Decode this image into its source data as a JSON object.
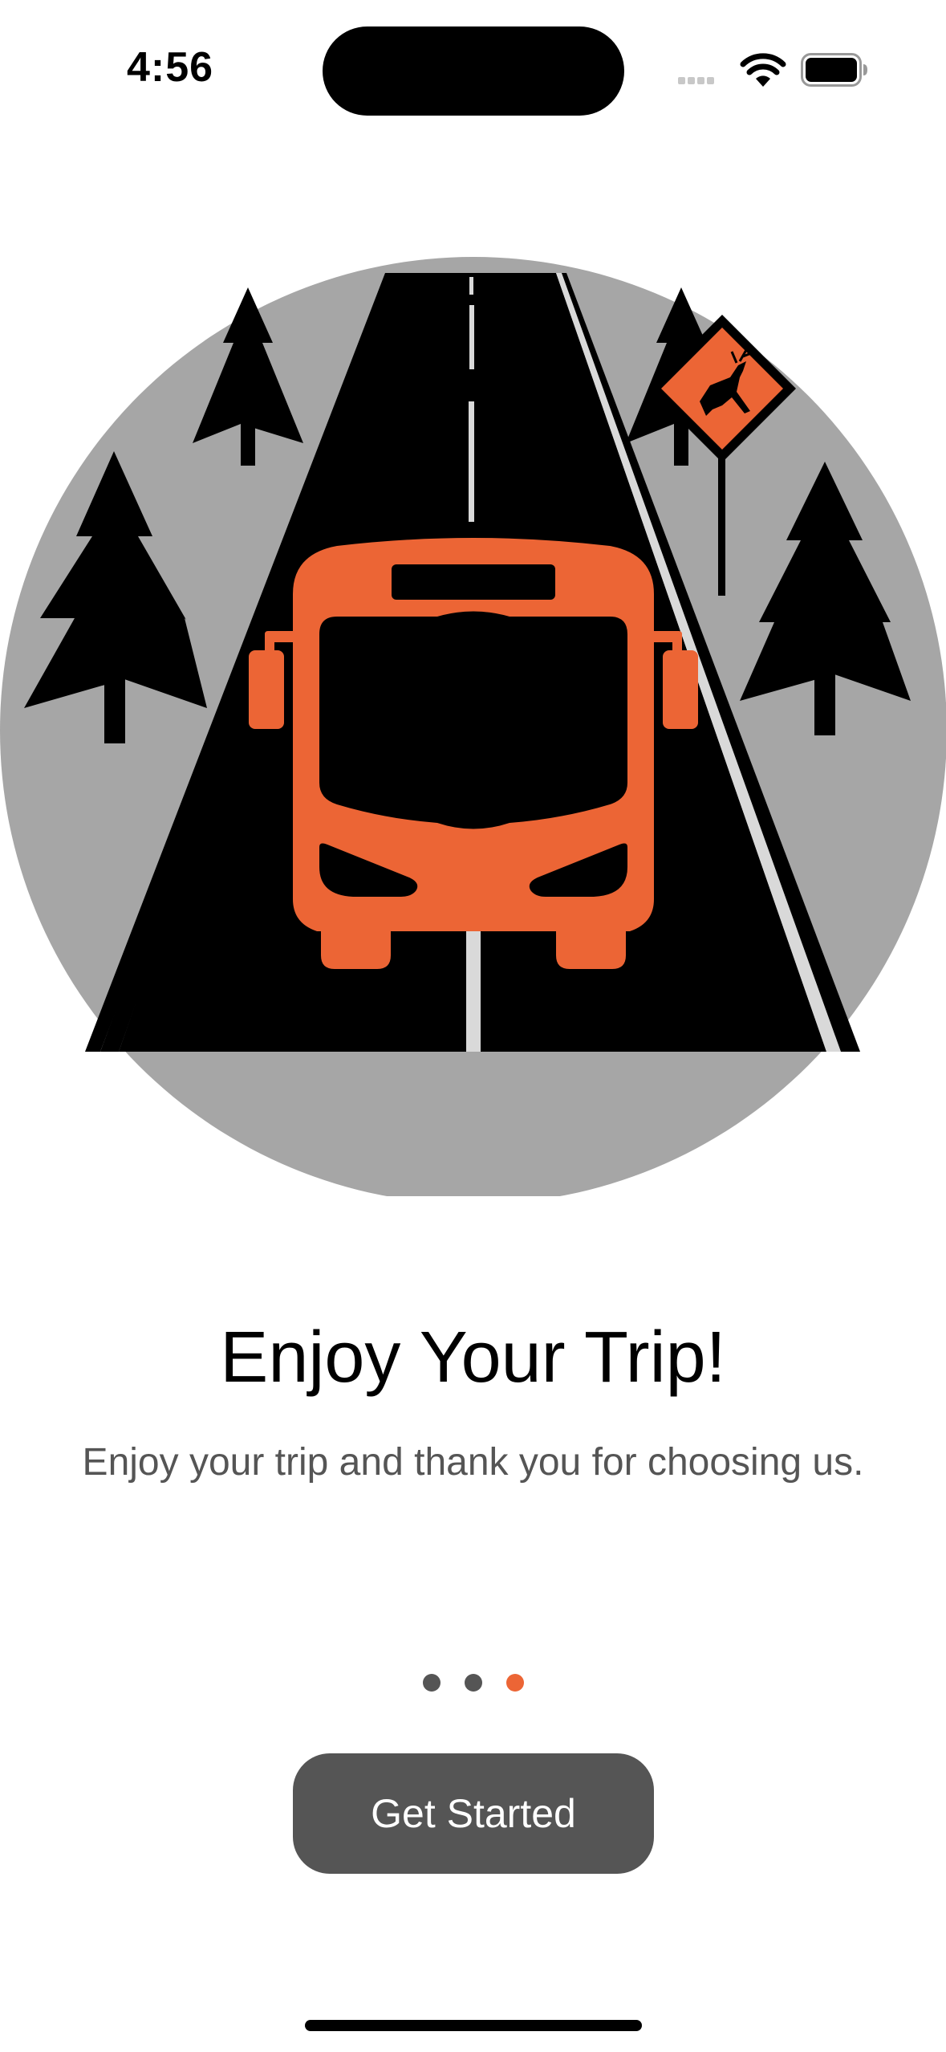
{
  "status_bar": {
    "time": "4:56",
    "icons": [
      "cellular-signal-icon",
      "wifi-icon",
      "battery-icon"
    ]
  },
  "illustration": {
    "description_icons": [
      "pine-tree-icon",
      "road-icon",
      "bus-icon",
      "deer-crossing-sign-icon"
    ],
    "colors": {
      "circle_background": "#a6a6a6",
      "accent": "#ec6535",
      "road": "#000000",
      "road_line": "#d9d9d9"
    }
  },
  "onboarding": {
    "title": "Enjoy Your Trip!",
    "subtitle": "Enjoy your trip and thank you for choosing us.",
    "page_count": 3,
    "current_page": 3,
    "button_label": "Get Started"
  },
  "colors": {
    "accent": "#ec6535",
    "button": "#555555",
    "subtitle": "#555555"
  }
}
